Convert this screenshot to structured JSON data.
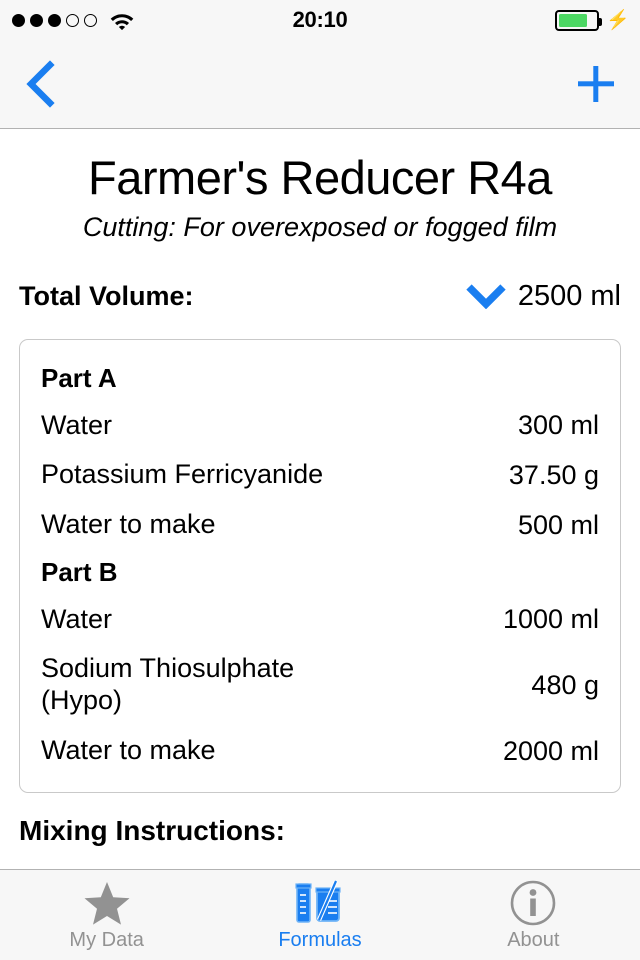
{
  "status_bar": {
    "signal_dots_filled": 3,
    "signal_dots_total": 5,
    "wifi_icon": "wifi-icon",
    "time": "20:10",
    "battery_percent": 68,
    "battery_color": "#4cd763",
    "charging_icon": "lightning-bolt-icon"
  },
  "nav_bar": {
    "back_icon": "chevron-left-icon",
    "add_icon": "plus-icon",
    "accent_color": "#1a7ef0",
    "background": "#f7f7f7"
  },
  "formula": {
    "title": "Farmer's Reducer R4a",
    "subtitle": "Cutting: For overexposed or fogged film",
    "total_volume_label": "Total Volume:",
    "total_volume_value": "2500 ml",
    "total_volume_chevron": "chevron-down-icon",
    "parts": [
      {
        "name": "Part A",
        "ingredients": [
          {
            "name": "Water",
            "amount": "300 ml"
          },
          {
            "name": "Potassium Ferricyanide",
            "amount": "37.50 g"
          },
          {
            "name": "Water to make",
            "amount": "500 ml"
          }
        ]
      },
      {
        "name": "Part B",
        "ingredients": [
          {
            "name": "Water",
            "amount": "1000 ml"
          },
          {
            "name": "Sodium Thiosulphate (Hypo)",
            "amount": "480 g"
          },
          {
            "name": "Water to make",
            "amount": "2000 ml"
          }
        ]
      }
    ],
    "mixing_instructions_heading": "Mixing Instructions:"
  },
  "tab_bar": {
    "active_color": "#1a7ef0",
    "inactive_color": "#929292",
    "tabs": [
      {
        "label": "My Data",
        "icon": "star-icon",
        "active": false
      },
      {
        "label": "Formulas",
        "icon": "beaker-icon",
        "active": true
      },
      {
        "label": "About",
        "icon": "info-icon",
        "active": false
      }
    ]
  }
}
